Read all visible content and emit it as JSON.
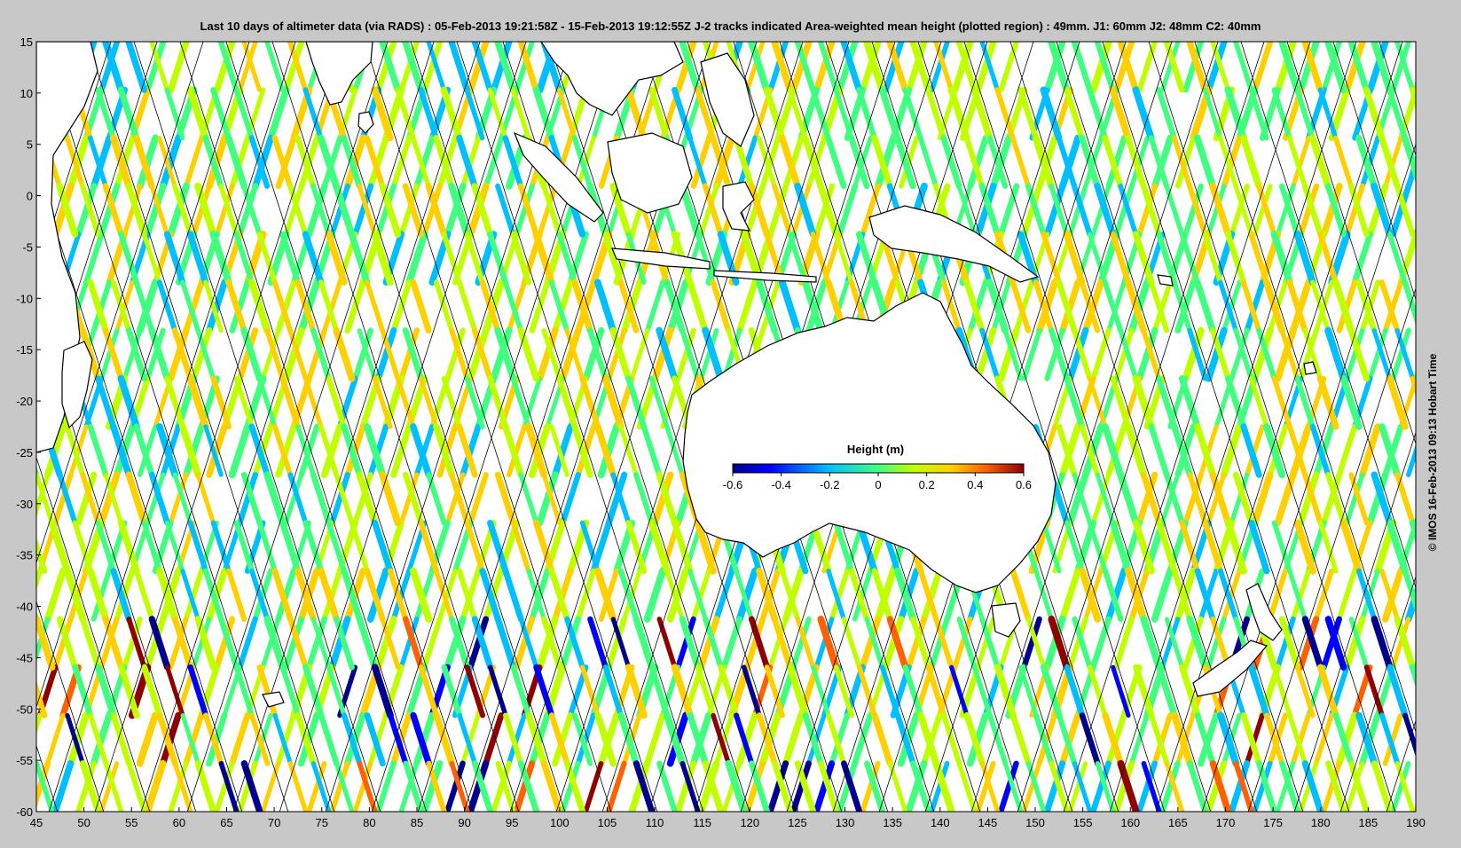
{
  "title": "Last 10 days of altimeter data (via RADS) : 05-Feb-2013 19:21:58Z - 15-Feb-2013 19:12:55Z  J-2 tracks indicated  Area-weighted mean height (plotted region) : 49mm.  J1: 60mm  J2: 48mm  C2: 40mm",
  "credit": "© IMOS 16-Feb-2013 09:13 Hobart Time",
  "axes": {
    "x_ticks": [
      "45",
      "50",
      "55",
      "60",
      "65",
      "70",
      "75",
      "80",
      "85",
      "90",
      "95",
      "100",
      "105",
      "110",
      "115",
      "120",
      "125",
      "130",
      "135",
      "140",
      "145",
      "150",
      "155",
      "160",
      "165",
      "170",
      "175",
      "180",
      "185",
      "190"
    ],
    "y_ticks": [
      "15",
      "10",
      "5",
      "0",
      "-5",
      "-10",
      "-15",
      "-20",
      "-25",
      "-30",
      "-35",
      "-40",
      "-45",
      "-50",
      "-55",
      "-60"
    ],
    "lon_range": [
      45,
      190
    ],
    "lat_range": [
      -60,
      15
    ]
  },
  "colorbar": {
    "label": "Height (m)",
    "ticks": [
      "-0.6",
      "-0.4",
      "-0.2",
      "0",
      "0.2",
      "0.4",
      "0.6"
    ],
    "range": [
      -0.6,
      0.6
    ],
    "colormap": [
      "#00008f",
      "#0000ff",
      "#00bfff",
      "#40ff80",
      "#c0ff00",
      "#ffd000",
      "#ff6000",
      "#900000"
    ]
  },
  "colors": {
    "background": "#c8c8c8",
    "plot_area": "#ffffff",
    "track_line": "#000000",
    "coast": "#000000"
  }
}
